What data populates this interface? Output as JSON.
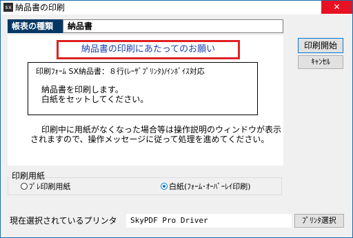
{
  "window": {
    "app_icon_text": "sx",
    "title": "納品書の印刷",
    "close_glyph": "✕"
  },
  "form_type": {
    "label": "帳表の種類",
    "value": "納品書"
  },
  "panel": {
    "headline": "納品書の印刷にあたってのお願い",
    "info_title": "印刷ﾌｫｰﾑ SX納品書：８行(ﾚｰｻﾞﾌﾟﾘﾝﾀ)/ｲﾝﾎﾞｲｽ対応",
    "info_lines": [
      "納品書を印刷します。",
      "白紙をセットしてください。"
    ],
    "notice": "印刷中に用紙がなくなった場合等は操作説明のウィンドウが表示されますので、操作メッセージに従って処理を進めてください。"
  },
  "buttons": {
    "print_start": "印刷開始",
    "cancel": "ｷｬﾝｾﾙ",
    "printer_select": "ﾌﾟﾘﾝﾀ選択"
  },
  "paper": {
    "group_label": "印刷用紙",
    "options": [
      {
        "label": "ﾌﾟﾚ印刷用紙",
        "selected": false
      },
      {
        "label": "白紙(ﾌｫｰﾑ･ｵｰﾊﾞｰﾚｲ印刷)",
        "selected": true
      }
    ]
  },
  "printer": {
    "label": "現在選択されているプリンタ",
    "value": "SkyPDF Pro Driver"
  },
  "colors": {
    "title_band": "#063764",
    "headline_border": "#e02020",
    "headline_text": "#1b3fae",
    "close_button": "#e81123",
    "accent": "#0078d7"
  }
}
